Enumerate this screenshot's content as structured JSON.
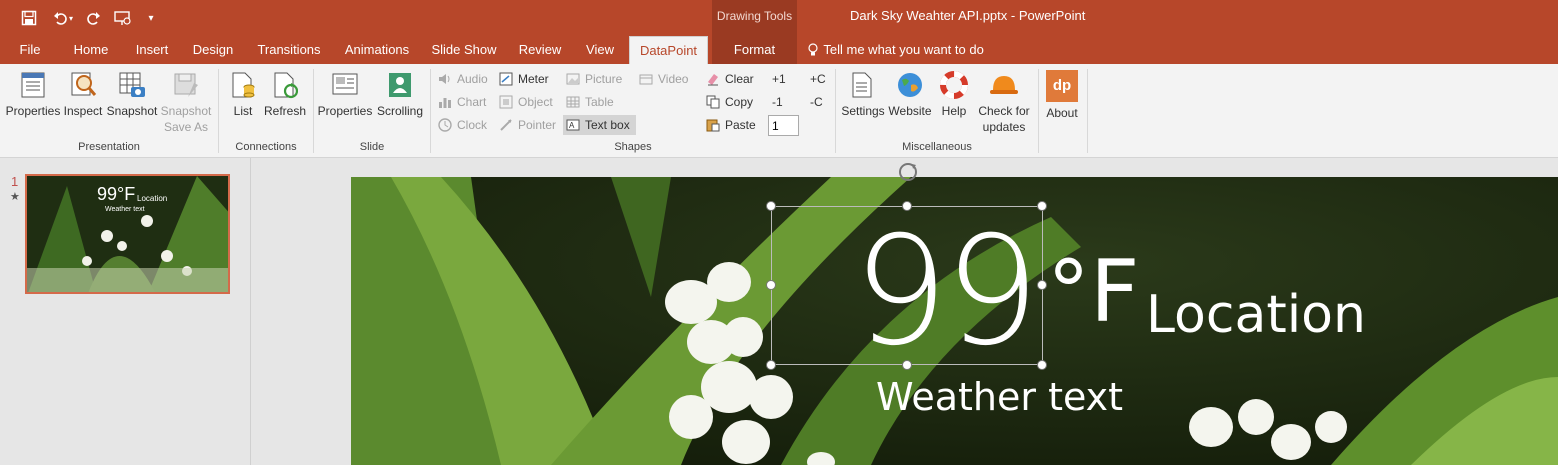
{
  "window": {
    "title": "Dark Sky Weahter API.pptx  -  PowerPoint",
    "context_group": "Drawing Tools"
  },
  "quick_access": [
    "save-icon",
    "undo-icon",
    "redo-icon",
    "start-slideshow-icon",
    "customize-icon"
  ],
  "tabs": [
    {
      "label": "File"
    },
    {
      "label": "Home"
    },
    {
      "label": "Insert"
    },
    {
      "label": "Design"
    },
    {
      "label": "Transitions"
    },
    {
      "label": "Animations"
    },
    {
      "label": "Slide Show"
    },
    {
      "label": "Review"
    },
    {
      "label": "View"
    },
    {
      "label": "DataPoint"
    },
    {
      "label": "Format"
    }
  ],
  "tell_me": "Tell me what you want to do",
  "ribbon": {
    "presentation": {
      "label": "Presentation",
      "properties": "Properties",
      "inspect": "Inspect",
      "snapshot": "Snapshot",
      "snapshot_save_as_1": "Snapshot",
      "snapshot_save_as_2": "Save As"
    },
    "connections": {
      "label": "Connections",
      "list": "List",
      "refresh": "Refresh"
    },
    "slide": {
      "label": "Slide",
      "properties": "Properties",
      "scrolling": "Scrolling"
    },
    "shapes": {
      "label": "Shapes",
      "audio": "Audio",
      "chart": "Chart",
      "clock": "Clock",
      "meter": "Meter",
      "object": "Object",
      "pointer": "Pointer",
      "picture": "Picture",
      "table": "Table",
      "textbox": "Text box",
      "video": "Video"
    },
    "edit": {
      "clear": "Clear",
      "copy": "Copy",
      "paste": "Paste",
      "plus1": "+1",
      "minus1": "-1",
      "step_value": "1",
      "plusC": "+C",
      "minusC": "-C"
    },
    "misc": {
      "label": "Miscellaneous",
      "settings": "Settings",
      "website": "Website",
      "help": "Help",
      "check_updates_1": "Check for",
      "check_updates_2": "updates",
      "about": "About",
      "about_logo": "dp"
    }
  },
  "thumbnails": [
    {
      "number": "1",
      "marker": "★",
      "temp": "99",
      "unit": "°F",
      "location": "Location",
      "weather": "Weather text"
    }
  ],
  "slide": {
    "temperature": "99",
    "unit": "°F",
    "location": "Location",
    "weather": "Weather text"
  },
  "colors": {
    "accent": "#b7472a",
    "context_tab": "#9a3a22",
    "ribbon_bg": "#f3f3f3"
  }
}
